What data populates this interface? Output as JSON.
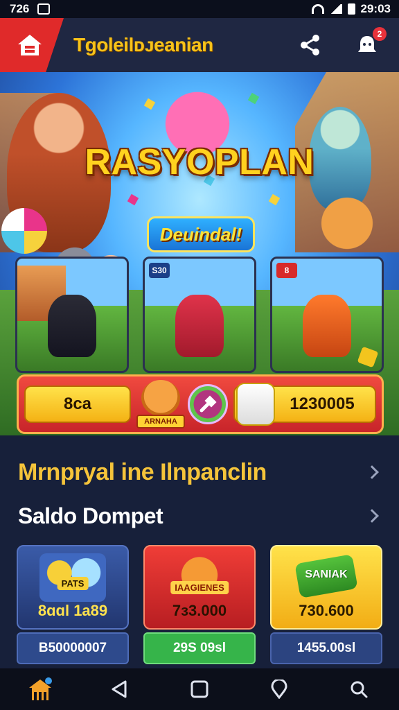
{
  "status_bar": {
    "time_left": "726",
    "time_right": "29:03"
  },
  "app_bar": {
    "title": "Tgoleilᴅᴊeanian",
    "notification_count": "2"
  },
  "hero": {
    "title": "RASYOPLAN",
    "download_label": "Deuindal!",
    "game_cards": [
      {
        "badge": ""
      },
      {
        "badge": "S30"
      },
      {
        "badge": "8"
      }
    ],
    "rewards": {
      "left_value": "8ca",
      "mascot_label": "ARNAHA",
      "right_value": "1230005"
    }
  },
  "sections": {
    "promo_title": "Mrnpryal ine Ilnpanclin",
    "wallet_title": "Saldo Dompet"
  },
  "wallet_cards": [
    {
      "art_label": "PATS",
      "value": "8ɑɑl 1a89",
      "balance": "B50000007"
    },
    {
      "art_label": "IAAGIENES",
      "value": "7з3.000",
      "balance": "29S 09sl"
    },
    {
      "art_label": "SANIAK",
      "value": "730.600",
      "balance": "1455.00sl"
    }
  ],
  "icons": {
    "home": "home-icon",
    "share": "share-icon",
    "notification": "notification-icon",
    "nav": [
      "shop-home-icon",
      "back-icon",
      "square-icon",
      "location-icon",
      "search-icon"
    ]
  },
  "colors": {
    "accent_yellow": "#f5c43a",
    "accent_red": "#e02a2a",
    "background": "#17203a"
  }
}
